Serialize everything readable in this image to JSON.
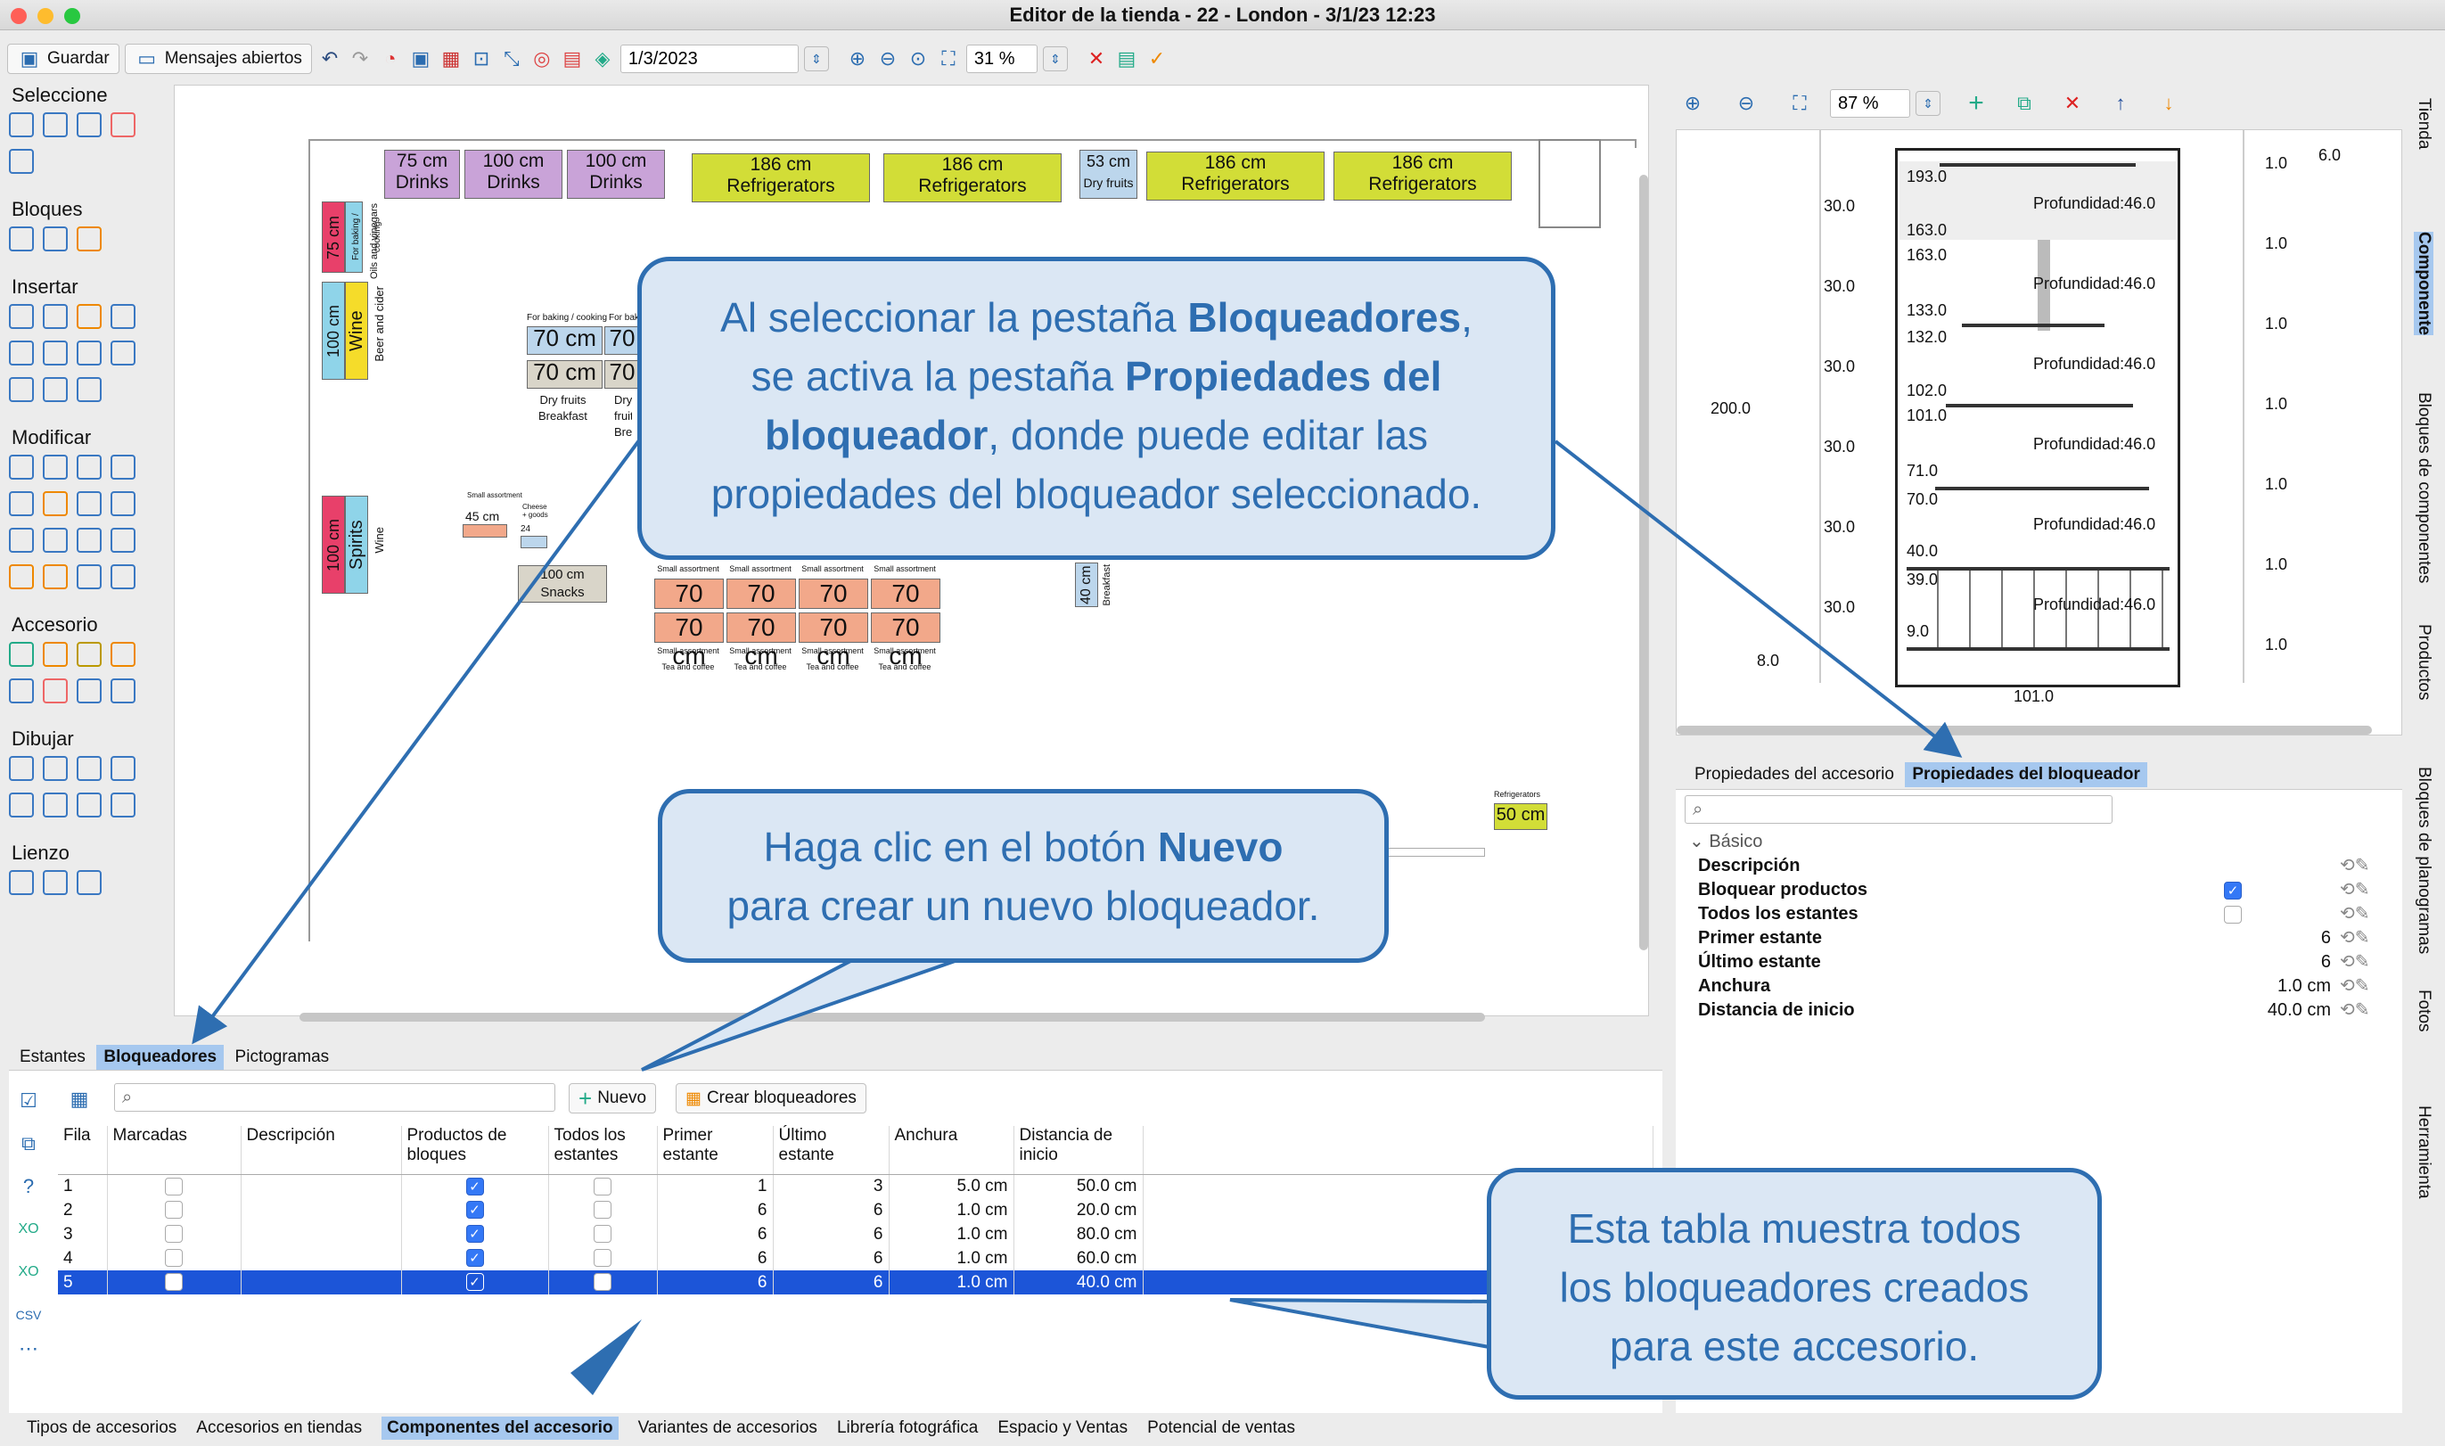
{
  "window": {
    "title": "Editor de la tienda - 22 - London - 3/1/23 12:23"
  },
  "toolbar": {
    "save": "Guardar",
    "messages": "Mensajes abiertos",
    "date": "1/3/2023",
    "zoom": "31 %"
  },
  "right_toolbar": {
    "zoom": "87 %"
  },
  "side_panel": {
    "sections": [
      "Seleccione",
      "Bloques",
      "Insertar",
      "Modificar",
      "Accesorio",
      "Dibujar",
      "Lienzo"
    ]
  },
  "fixtures_top": [
    {
      "size": "75 cm",
      "label": "Drinks"
    },
    {
      "size": "100 cm",
      "label": "Drinks"
    },
    {
      "size": "100 cm",
      "label": "Drinks"
    },
    {
      "size": "186 cm",
      "label": "Refrigerators"
    },
    {
      "size": "186 cm",
      "label": "Refrigerators"
    },
    {
      "size": "53 cm",
      "label": "Dry fruits"
    },
    {
      "size": "186 cm",
      "label": "Refrigerators"
    },
    {
      "size": "186 cm",
      "label": "Refrigerators"
    }
  ],
  "fixtures_left": [
    {
      "size": "75 cm",
      "label": "For baking / cooking",
      "aside": "Oils and vinegars"
    },
    {
      "size": "100 cm",
      "label": "Wine",
      "aside": "Beer and cider"
    },
    {
      "size": "100 cm",
      "label": "Spirits",
      "aside": "Wine"
    }
  ],
  "fixtures_misc": {
    "dry_labels": [
      "For baking / cooking",
      "For baking"
    ],
    "dry_lines": [
      "Dry fruits",
      "Breakfast"
    ],
    "small": "Small assortment",
    "sm45": "45 cm",
    "cheese": "Cheese + goods",
    "snacks_size": "100 cm",
    "snacks": "Snacks",
    "bf_size": "40 cm",
    "bf_label": "Breakfast",
    "fridge_label": "Refrigerators",
    "fridge_size": "50 cm",
    "tea": "Tea and coffee",
    "seventy": "70 cm",
    "w24": "24"
  },
  "bottom_tabs": {
    "items": [
      "Estantes",
      "Bloqueadores",
      "Pictogramas"
    ],
    "selected": "Bloqueadores"
  },
  "actions": {
    "new": "Nuevo",
    "create": "Crear bloqueadores"
  },
  "table": {
    "headers": [
      "Fila",
      "Marcadas",
      "Descripción",
      "Productos de bloques",
      "Todos los estantes",
      "Primer estante",
      "Último estante",
      "Anchura",
      "Distancia de inicio"
    ],
    "rows": [
      {
        "fila": "1",
        "first": "1",
        "last": "3",
        "width": "5.0 cm",
        "dist": "50.0 cm",
        "marked": false,
        "block": true,
        "all": false
      },
      {
        "fila": "2",
        "first": "6",
        "last": "6",
        "width": "1.0 cm",
        "dist": "20.0 cm",
        "marked": false,
        "block": true,
        "all": false
      },
      {
        "fila": "3",
        "first": "6",
        "last": "6",
        "width": "1.0 cm",
        "dist": "80.0 cm",
        "marked": false,
        "block": true,
        "all": false
      },
      {
        "fila": "4",
        "first": "6",
        "last": "6",
        "width": "1.0 cm",
        "dist": "60.0 cm",
        "marked": false,
        "block": true,
        "all": false
      },
      {
        "fila": "5",
        "first": "6",
        "last": "6",
        "width": "1.0 cm",
        "dist": "40.0 cm",
        "marked": false,
        "block": true,
        "all": false
      }
    ]
  },
  "elevation": {
    "total_height": "200.0",
    "bottom_width": "101.0",
    "base": "8.0",
    "top_right": "6.0",
    "left_dims": [
      "30.0",
      "30.0",
      "30.0",
      "30.0",
      "30.0",
      "30.0"
    ],
    "heights": [
      "193.0",
      "163.0",
      "163.0",
      "133.0",
      "132.0",
      "102.0",
      "101.0",
      "71.0",
      "70.0",
      "40.0",
      "39.0",
      "9.0"
    ],
    "depth": "Profundidad:46.0",
    "right_dims": [
      "1.0",
      "1.0",
      "1.0",
      "1.0",
      "1.0",
      "1.0",
      "1.0"
    ]
  },
  "prop_tabs": {
    "items": [
      "Propiedades del accesorio",
      "Propiedades del bloqueador"
    ],
    "selected": "Propiedades del bloqueador"
  },
  "properties": {
    "section": "Básico",
    "rows": [
      {
        "label": "Descripción",
        "value": ""
      },
      {
        "label": "Bloquear productos",
        "value": ""
      },
      {
        "label": "Todos los estantes",
        "value": ""
      },
      {
        "label": "Primer estante",
        "value": "6"
      },
      {
        "label": "Último estante",
        "value": "6"
      },
      {
        "label": "Anchura",
        "value": "1.0 cm"
      },
      {
        "label": "Distancia de inicio",
        "value": "40.0 cm"
      }
    ]
  },
  "right_side_tabs": [
    "Tienda",
    "Componente",
    "Bloques de componentes",
    "Productos",
    "Bloques de planogramas",
    "Fotos",
    "Herramienta"
  ],
  "bottom_bar": [
    "Tipos de accesorios",
    "Accesorios en tiendas",
    "Componentes del accesorio",
    "Variantes de accesorios",
    "Librería fotográfica",
    "Espacio y Ventas",
    "Potencial de ventas"
  ],
  "callouts": {
    "c1": {
      "t1": "Al seleccionar la pestaña ",
      "b1": "Bloqueadores",
      "t2": ",",
      "t3": "se activa la pestaña ",
      "b2": "Propiedades del",
      "b3": "bloqueador",
      "t4": ", donde puede editar las",
      "t5": "propiedades del bloqueador seleccionado."
    },
    "c2": {
      "t1": "Haga clic en el botón ",
      "b1": "Nuevo",
      "t2": "para crear un nuevo bloqueador."
    },
    "c3": {
      "l1": "Esta tabla muestra todos",
      "l2": "los bloqueadores creados",
      "l3": "para este accesorio."
    }
  }
}
